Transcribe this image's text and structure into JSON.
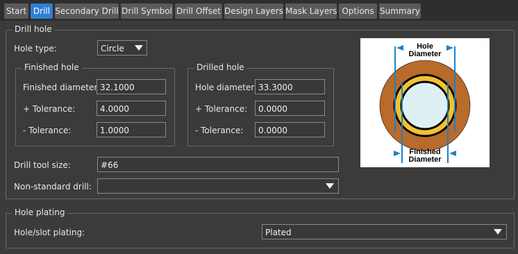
{
  "tabs": [
    {
      "label": "Start",
      "active": false
    },
    {
      "label": "Drill",
      "active": true
    },
    {
      "label": "Secondary Drill",
      "active": false
    },
    {
      "label": "Drill Symbol",
      "active": false
    },
    {
      "label": "Drill Offset",
      "active": false
    },
    {
      "label": "Design Layers",
      "active": false
    },
    {
      "label": "Mask Layers",
      "active": false
    },
    {
      "label": "Options",
      "active": false
    },
    {
      "label": "Summary",
      "active": false
    }
  ],
  "drill_hole": {
    "legend": "Drill hole",
    "hole_type_label": "Hole type:",
    "hole_type_value": "Circle",
    "finished": {
      "legend": "Finished hole",
      "diameter_label": "Finished diameter:",
      "diameter_value": "32.1000",
      "plus_tol_label": "+ Tolerance:",
      "plus_tol_value": "4.0000",
      "minus_tol_label": "- Tolerance:",
      "minus_tol_value": "1.0000"
    },
    "drilled": {
      "legend": "Drilled hole",
      "diameter_label": "Hole diameter:",
      "diameter_value": "33.3000",
      "plus_tol_label": "+ Tolerance:",
      "plus_tol_value": "0.0000",
      "minus_tol_label": "- Tolerance:",
      "minus_tol_value": "0.0000"
    },
    "tool_size_label": "Drill tool size:",
    "tool_size_value": "#66",
    "non_standard_label": "Non-standard drill:",
    "non_standard_value": "",
    "diagram": {
      "top_line1": "Hole",
      "top_line2": "Diameter",
      "bottom_line1": "Finished",
      "bottom_line2": "Diameter"
    }
  },
  "hole_plating": {
    "legend": "Hole plating",
    "label": "Hole/slot plating:",
    "value": "Plated"
  },
  "colors": {
    "active_tab": "#2f7fd3",
    "background": "#3b3b3b",
    "copper": "#b86b2a",
    "plating": "#f2c230",
    "hole": "#dff0f5",
    "dimension": "#1f7fc4"
  }
}
